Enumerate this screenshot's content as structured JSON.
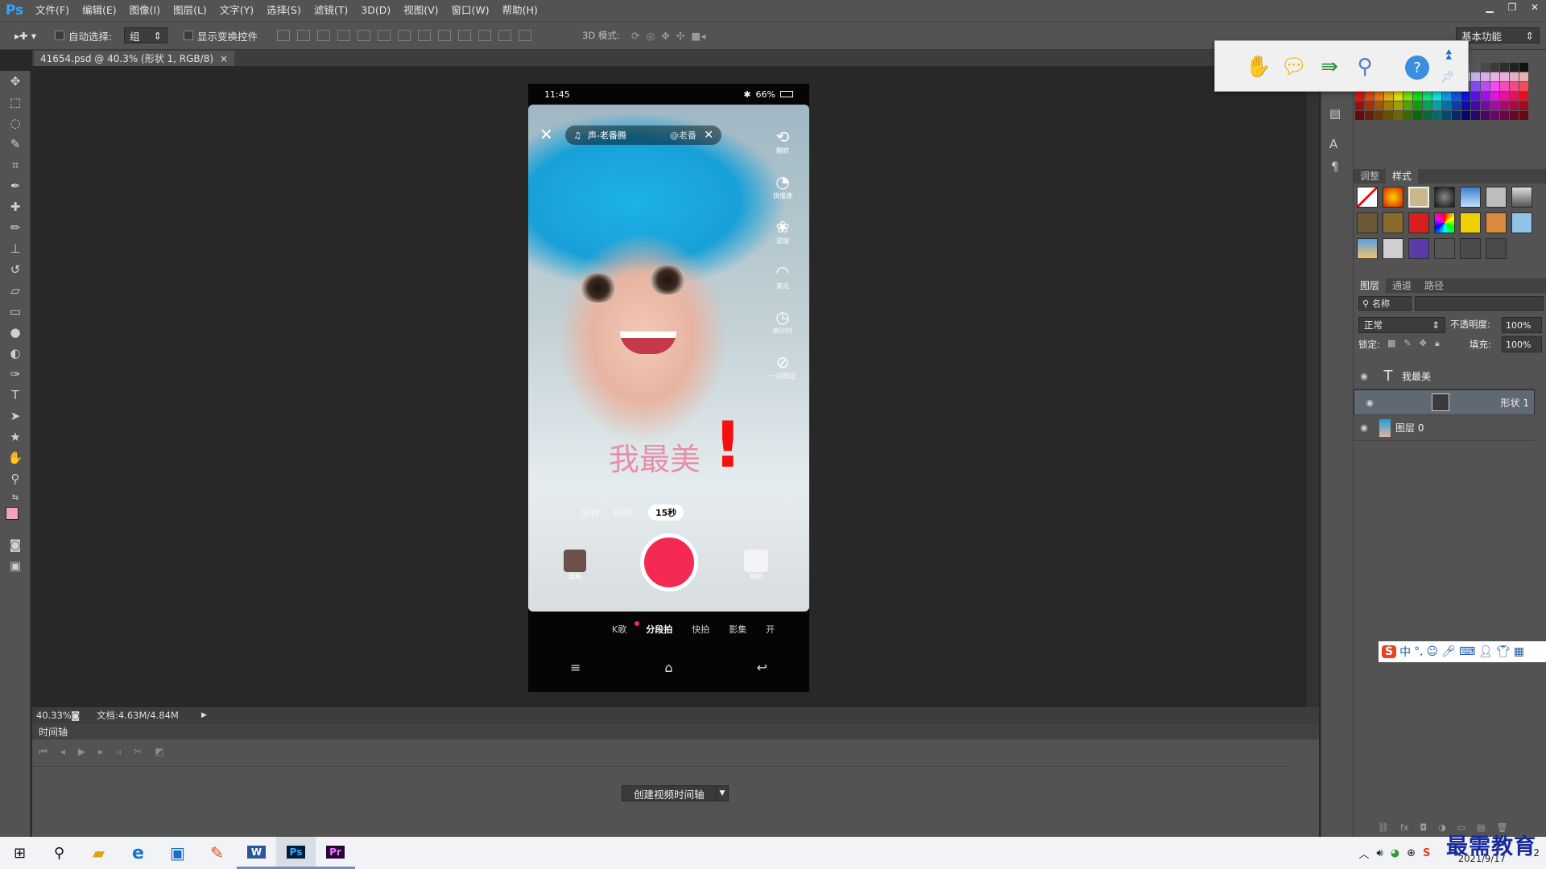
{
  "app": {
    "logo": "Ps"
  },
  "menu": [
    "文件(F)",
    "编辑(E)",
    "图像(I)",
    "图层(L)",
    "文字(Y)",
    "选择(S)",
    "滤镜(T)",
    "3D(D)",
    "视图(V)",
    "窗口(W)",
    "帮助(H)"
  ],
  "options": {
    "auto_select_label": "自动选择:",
    "auto_select_value": "组",
    "show_transform_label": "显示变换控件",
    "mode3d_label": "3D 模式:",
    "workspace_value": "基本功能"
  },
  "document": {
    "tab_title": "41654.psd @ 40.3% (形状 1, RGB/8)",
    "close_glyph": "×"
  },
  "status": {
    "zoom": "40.33%",
    "doc_info": "文档:4.63M/4.84M"
  },
  "phone_ui": {
    "time": "11:45",
    "battery": "66%",
    "music_title": "声-老番腾",
    "music_author": "@老番",
    "caption": "我最美",
    "exclaim": "!",
    "durations": [
      "分钟",
      "60秒",
      "15秒"
    ],
    "side_labels": [
      "翻转",
      "快慢速",
      "滤镜",
      "美化",
      "倒计时",
      "一闪而过"
    ],
    "props_label": "道具",
    "album_label": "相册",
    "modes": [
      "K歌",
      "分段拍",
      "快拍",
      "影集",
      "开"
    ]
  },
  "timeline": {
    "title": "时间轴",
    "create_button": "创建视频时间轴"
  },
  "panels": {
    "adjust_tabs": [
      "调整",
      "样式"
    ],
    "layer_tabs": [
      "图层",
      "通道",
      "路径"
    ],
    "filter_kind": "名称",
    "blend_mode": "正常",
    "opacity_label": "不透明度:",
    "opacity_value": "100%",
    "lock_label": "锁定:",
    "fill_label": "填充:",
    "fill_value": "100%",
    "layers": [
      {
        "name": "我最美",
        "kind": "text",
        "selected": false
      },
      {
        "name": "形状 1",
        "kind": "shape",
        "selected": true
      },
      {
        "name": "图层 0",
        "kind": "image",
        "selected": false
      }
    ]
  },
  "colors": {
    "foreground": "#f2a3b9",
    "background": "#ffffff",
    "accent_ps": "#31a8ff",
    "record": "#f42a55",
    "caption": "#e98ea7",
    "exclaim": "#f41010"
  },
  "ime": {
    "label": "中",
    "punct": "°,"
  },
  "taskbar": {
    "date": "2021/9/17",
    "notify_count": "2",
    "watermark": "最需教育"
  }
}
